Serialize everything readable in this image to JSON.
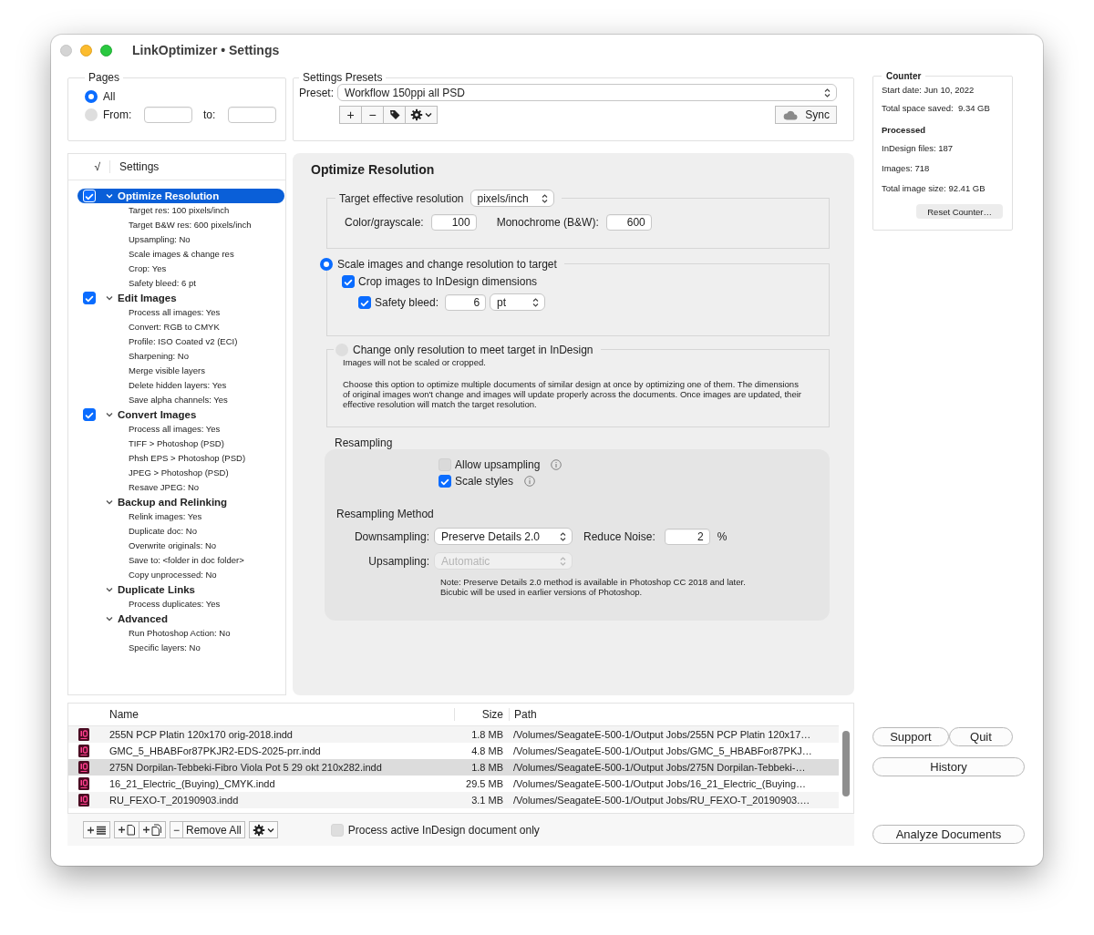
{
  "window": {
    "title": "LinkOptimizer • Settings"
  },
  "pages": {
    "title": "Pages",
    "options": [
      {
        "label": "All",
        "selected": true
      },
      {
        "label": "From:",
        "selected": false
      }
    ],
    "to_label": "to:"
  },
  "presets": {
    "title": "Settings Presets",
    "preset_label": "Preset:",
    "preset_value": "Workflow 150ppi all PSD",
    "add_label": "+",
    "remove_label": "−",
    "sync_button": "Sync"
  },
  "settings_tree": {
    "header_check": "√",
    "header": "Settings",
    "groups": [
      {
        "title": "Optimize Resolution",
        "kind": "checkable",
        "checked": true,
        "selected": true,
        "expanded": true,
        "children": [
          {
            "label": "Target res: 100 pixels/inch"
          },
          {
            "label": "Target B&W res: 600 pixels/inch"
          },
          {
            "label": "Upsampling: No"
          },
          {
            "label": "Scale images & change res"
          },
          {
            "label": "Crop: Yes"
          },
          {
            "label": "Safety bleed: 6 pt"
          }
        ]
      },
      {
        "title": "Edit Images",
        "kind": "checkable",
        "checked": true,
        "selected": false,
        "expanded": true,
        "children": [
          {
            "label": "Process all images: Yes"
          },
          {
            "label": "Convert: RGB to CMYK"
          },
          {
            "label": "Profile: ISO Coated v2 (ECI)"
          },
          {
            "label": "Sharpening: No"
          },
          {
            "label": "Merge visible layers"
          },
          {
            "label": "Delete hidden layers: Yes"
          },
          {
            "label": "Save alpha channels: Yes"
          }
        ]
      },
      {
        "title": "Convert Images",
        "kind": "checkable",
        "checked": true,
        "selected": false,
        "expanded": true,
        "children": [
          {
            "label": "Process all images: Yes"
          },
          {
            "label": "TIFF > Photoshop (PSD)"
          },
          {
            "label": "Phsh EPS > Photoshop (PSD)"
          },
          {
            "label": "JPEG > Photoshop (PSD)"
          },
          {
            "label": "Resave JPEG: No"
          }
        ]
      },
      {
        "title": "Backup and Relinking",
        "kind": "plain",
        "selected": false,
        "expanded": true,
        "children": [
          {
            "label": "Relink images: Yes"
          },
          {
            "label": "Duplicate doc: No"
          },
          {
            "label": "Overwrite originals: No"
          },
          {
            "label": "Save to: <folder in doc folder>"
          },
          {
            "label": "Copy unprocessed: No"
          }
        ]
      },
      {
        "title": "Duplicate Links",
        "kind": "plain",
        "selected": false,
        "expanded": true,
        "children": [
          {
            "label": "Process duplicates: Yes"
          }
        ]
      },
      {
        "title": "Advanced",
        "kind": "plain",
        "selected": false,
        "expanded": true,
        "children": [
          {
            "label": "Run Photoshop Action: No"
          },
          {
            "label": "Specific layers: No"
          }
        ]
      }
    ]
  },
  "panel": {
    "title": "Optimize Resolution",
    "target": {
      "label": "Target effective resolution",
      "unit": "pixels/inch",
      "color_label": "Color/grayscale:",
      "color_value": "100",
      "mono_label": "Monochrome (B&W):",
      "mono_value": "600"
    },
    "modes": [
      {
        "kind": "scale",
        "label": "Scale images and change resolution to target",
        "selected": true,
        "crop": {
          "label": "Crop images to InDesign dimensions",
          "checked": true
        },
        "bleed": {
          "label": "Safety bleed:",
          "checked": true,
          "value": "6",
          "unit": "pt"
        }
      },
      {
        "kind": "change",
        "label": "Change only resolution to meet target in InDesign",
        "selected": false,
        "note": "Images will not be scaled or cropped.",
        "description": "Choose this option to optimize multiple documents of similar design at once by optimizing one of them. The dimensions of original images won't change and images will update properly across the documents. Once images are updated, their effective resolution will match the target resolution."
      }
    ],
    "resampling": {
      "title": "Resampling",
      "options": [
        {
          "label": "Allow upsampling",
          "checked": false,
          "disabled": true
        },
        {
          "label": "Scale styles",
          "checked": true,
          "disabled": false
        }
      ],
      "method_title": "Resampling Method",
      "downsampling_label": "Downsampling:",
      "downsampling_value": "Preserve Details 2.0",
      "noise_label": "Reduce Noise:",
      "noise_value": "2",
      "noise_unit": "%",
      "upsampling_label": "Upsampling:",
      "upsampling_value": "Automatic",
      "upsampling_disabled": true,
      "note_lines": [
        "Note: Preserve Details 2.0 method is available in Photoshop CC 2018 and later.",
        "Bicubic will be used in earlier versions of Photoshop."
      ]
    }
  },
  "counter": {
    "title": "Counter",
    "lines": [
      "Start date: Jun 10, 2022",
      "Total space saved:  9.34 GB"
    ],
    "processed_title": "Processed",
    "stats": [
      "InDesign files: 187",
      "Images: 718",
      "Total image size: 92.41 GB"
    ],
    "reset_button": "Reset Counter…"
  },
  "files": {
    "columns": [
      "Name",
      "Size",
      "Path"
    ],
    "rows": [
      {
        "name": "255N PCP Platin 120x170 orig-2018.indd",
        "size": "1.8 MB",
        "path": "/Volumes/SeagateE-500-1/Output Jobs/255N PCP Platin 120x17…",
        "selected": false
      },
      {
        "name": "GMC_5_HBABFor87PKJR2-EDS-2025-prr.indd",
        "size": "4.8 MB",
        "path": "/Volumes/SeagateE-500-1/Output Jobs/GMC_5_HBABFor87PKJ…",
        "selected": false
      },
      {
        "name": "275N Dorpilan-Tebbeki-Fibro Viola Pot 5 29 okt 210x282.indd",
        "size": "1.8 MB",
        "path": "/Volumes/SeagateE-500-1/Output Jobs/275N Dorpilan-Tebbeki-…",
        "selected": true
      },
      {
        "name": "16_21_Electric_(Buying)_CMYK.indd",
        "size": "29.5 MB",
        "path": "/Volumes/SeagateE-500-1/Output Jobs/16_21_Electric_(Buying…",
        "selected": false
      },
      {
        "name": "RU_FEXO-T_20190903.indd",
        "size": "3.1 MB",
        "path": "/Volumes/SeagateE-500-1/Output Jobs/RU_FEXO-T_20190903.…",
        "selected": false
      }
    ],
    "remove_label": "−",
    "remove_all": "Remove All",
    "active_only": {
      "label": "Process active InDesign document only",
      "checked": false
    }
  },
  "buttons": {
    "support": "Support",
    "quit": "Quit",
    "history": "History",
    "analyze": "Analyze Documents"
  }
}
